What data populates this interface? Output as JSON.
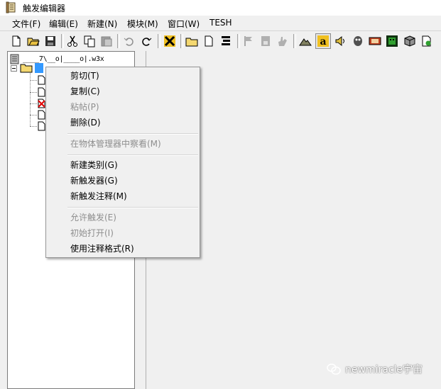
{
  "window": {
    "title": "触发编辑器"
  },
  "menubar": {
    "items": [
      {
        "label": "文件(F)",
        "name": "menu-file"
      },
      {
        "label": "编辑(E)",
        "name": "menu-edit"
      },
      {
        "label": "新建(N)",
        "name": "menu-new"
      },
      {
        "label": "模块(M)",
        "name": "menu-module"
      },
      {
        "label": "窗口(W)",
        "name": "menu-window"
      },
      {
        "label": "TESH",
        "name": "menu-tesh"
      }
    ]
  },
  "tree": {
    "root_label": "____7\\__o|____o|.w3x"
  },
  "context_menu": {
    "items": [
      {
        "label": "剪切(T)",
        "enabled": true
      },
      {
        "label": "复制(C)",
        "enabled": true
      },
      {
        "label": "粘帖(P)",
        "enabled": false
      },
      {
        "label": "删除(D)",
        "enabled": true
      },
      {
        "label": "在物体管理器中察看(M)",
        "enabled": false
      },
      {
        "label": "新建类别(G)",
        "enabled": true
      },
      {
        "label": "新触发器(G)",
        "enabled": true
      },
      {
        "label": "新触发注释(M)",
        "enabled": true
      },
      {
        "label": "允许触发(E)",
        "enabled": false
      },
      {
        "label": "初始打开(I)",
        "enabled": false
      },
      {
        "label": "使用注释格式(R)",
        "enabled": true
      }
    ]
  },
  "watermark": {
    "text": "newmiracle宇宙"
  },
  "colors": {
    "selection": "#3399ff",
    "menu_bg": "#f0f0f0",
    "disabled_text": "#8e8e8e"
  }
}
